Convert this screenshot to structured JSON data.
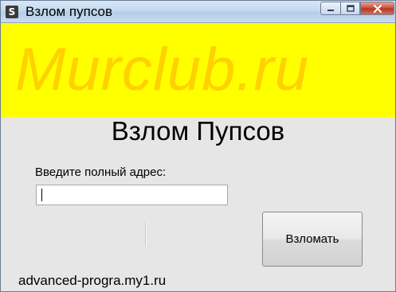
{
  "window": {
    "title": "Взлом пупсов",
    "icon_letter": "S"
  },
  "banner": {
    "logo_text": "Murclub.ru"
  },
  "main": {
    "heading": "Взлом Пупсов",
    "address_label": "Введите полный адрес:",
    "address_value": "",
    "hack_button_label": "Взломать"
  },
  "footer": {
    "site": "advanced-progra.my1.ru"
  }
}
